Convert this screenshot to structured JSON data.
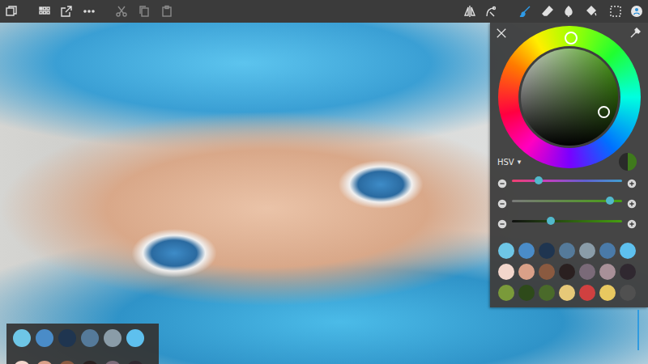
{
  "toolbar": {
    "left_tools": [
      {
        "disabled": false
      },
      {
        "disabled": false
      },
      {
        "disabled": false
      },
      {
        "disabled": false
      },
      {
        "disabled": true
      },
      {
        "disabled": true
      },
      {
        "disabled": true
      }
    ],
    "right_tools": [
      {
        "selected": false
      },
      {
        "selected": false
      },
      {
        "selected": true
      },
      {
        "selected": false
      },
      {
        "selected": false
      },
      {
        "selected": false
      },
      {
        "selected": false
      },
      {
        "selected": false
      }
    ]
  },
  "color_panel": {
    "mode": "HSV",
    "mode_arrow": "▾",
    "current_color": "#3f7a1c",
    "previous_color": "#2a2a2a",
    "sliders": [
      {
        "level": 0.24
      },
      {
        "level": 0.89
      },
      {
        "level": 0.35
      }
    ],
    "swatches": [
      {
        "color": "#6ec6e6"
      },
      {
        "color": "#4a8cc8"
      },
      {
        "color": "#1f3550"
      },
      {
        "color": "#557a9a"
      },
      {
        "color": "#8a9ca8"
      },
      {
        "color": "#4a7aa8"
      },
      {
        "color": "#5ec0ee"
      },
      {
        "color": "#f2d6cc"
      },
      {
        "color": "#d9a088"
      },
      {
        "color": "#8a5a40"
      },
      {
        "color": "#2a2020"
      },
      {
        "color": "#7a6a78"
      },
      {
        "color": "#a89098"
      },
      {
        "color": "#302830"
      },
      {
        "color": "#7a9a3a"
      },
      {
        "color": "#2e4a1a"
      },
      {
        "color": "#4a6a2a"
      },
      {
        "color": "#e6c878"
      },
      {
        "color": "#d04040"
      },
      {
        "color": "#e8c860"
      },
      {
        "color": "#505050"
      }
    ]
  },
  "mini_palette": {
    "swatches": [
      {
        "color": "#6ec6e6"
      },
      {
        "color": "#4a8cc8"
      },
      {
        "color": "#1f3550"
      },
      {
        "color": "#557a9a"
      },
      {
        "color": "#8a9ca8"
      },
      {
        "color": "#5ec0ee"
      },
      {
        "color": "#f2d6cc"
      },
      {
        "color": "#d9a088"
      },
      {
        "color": "#8a5a40"
      },
      {
        "color": "#2a2020"
      },
      {
        "color": "#7a6a78"
      },
      {
        "color": "#302830"
      }
    ]
  }
}
